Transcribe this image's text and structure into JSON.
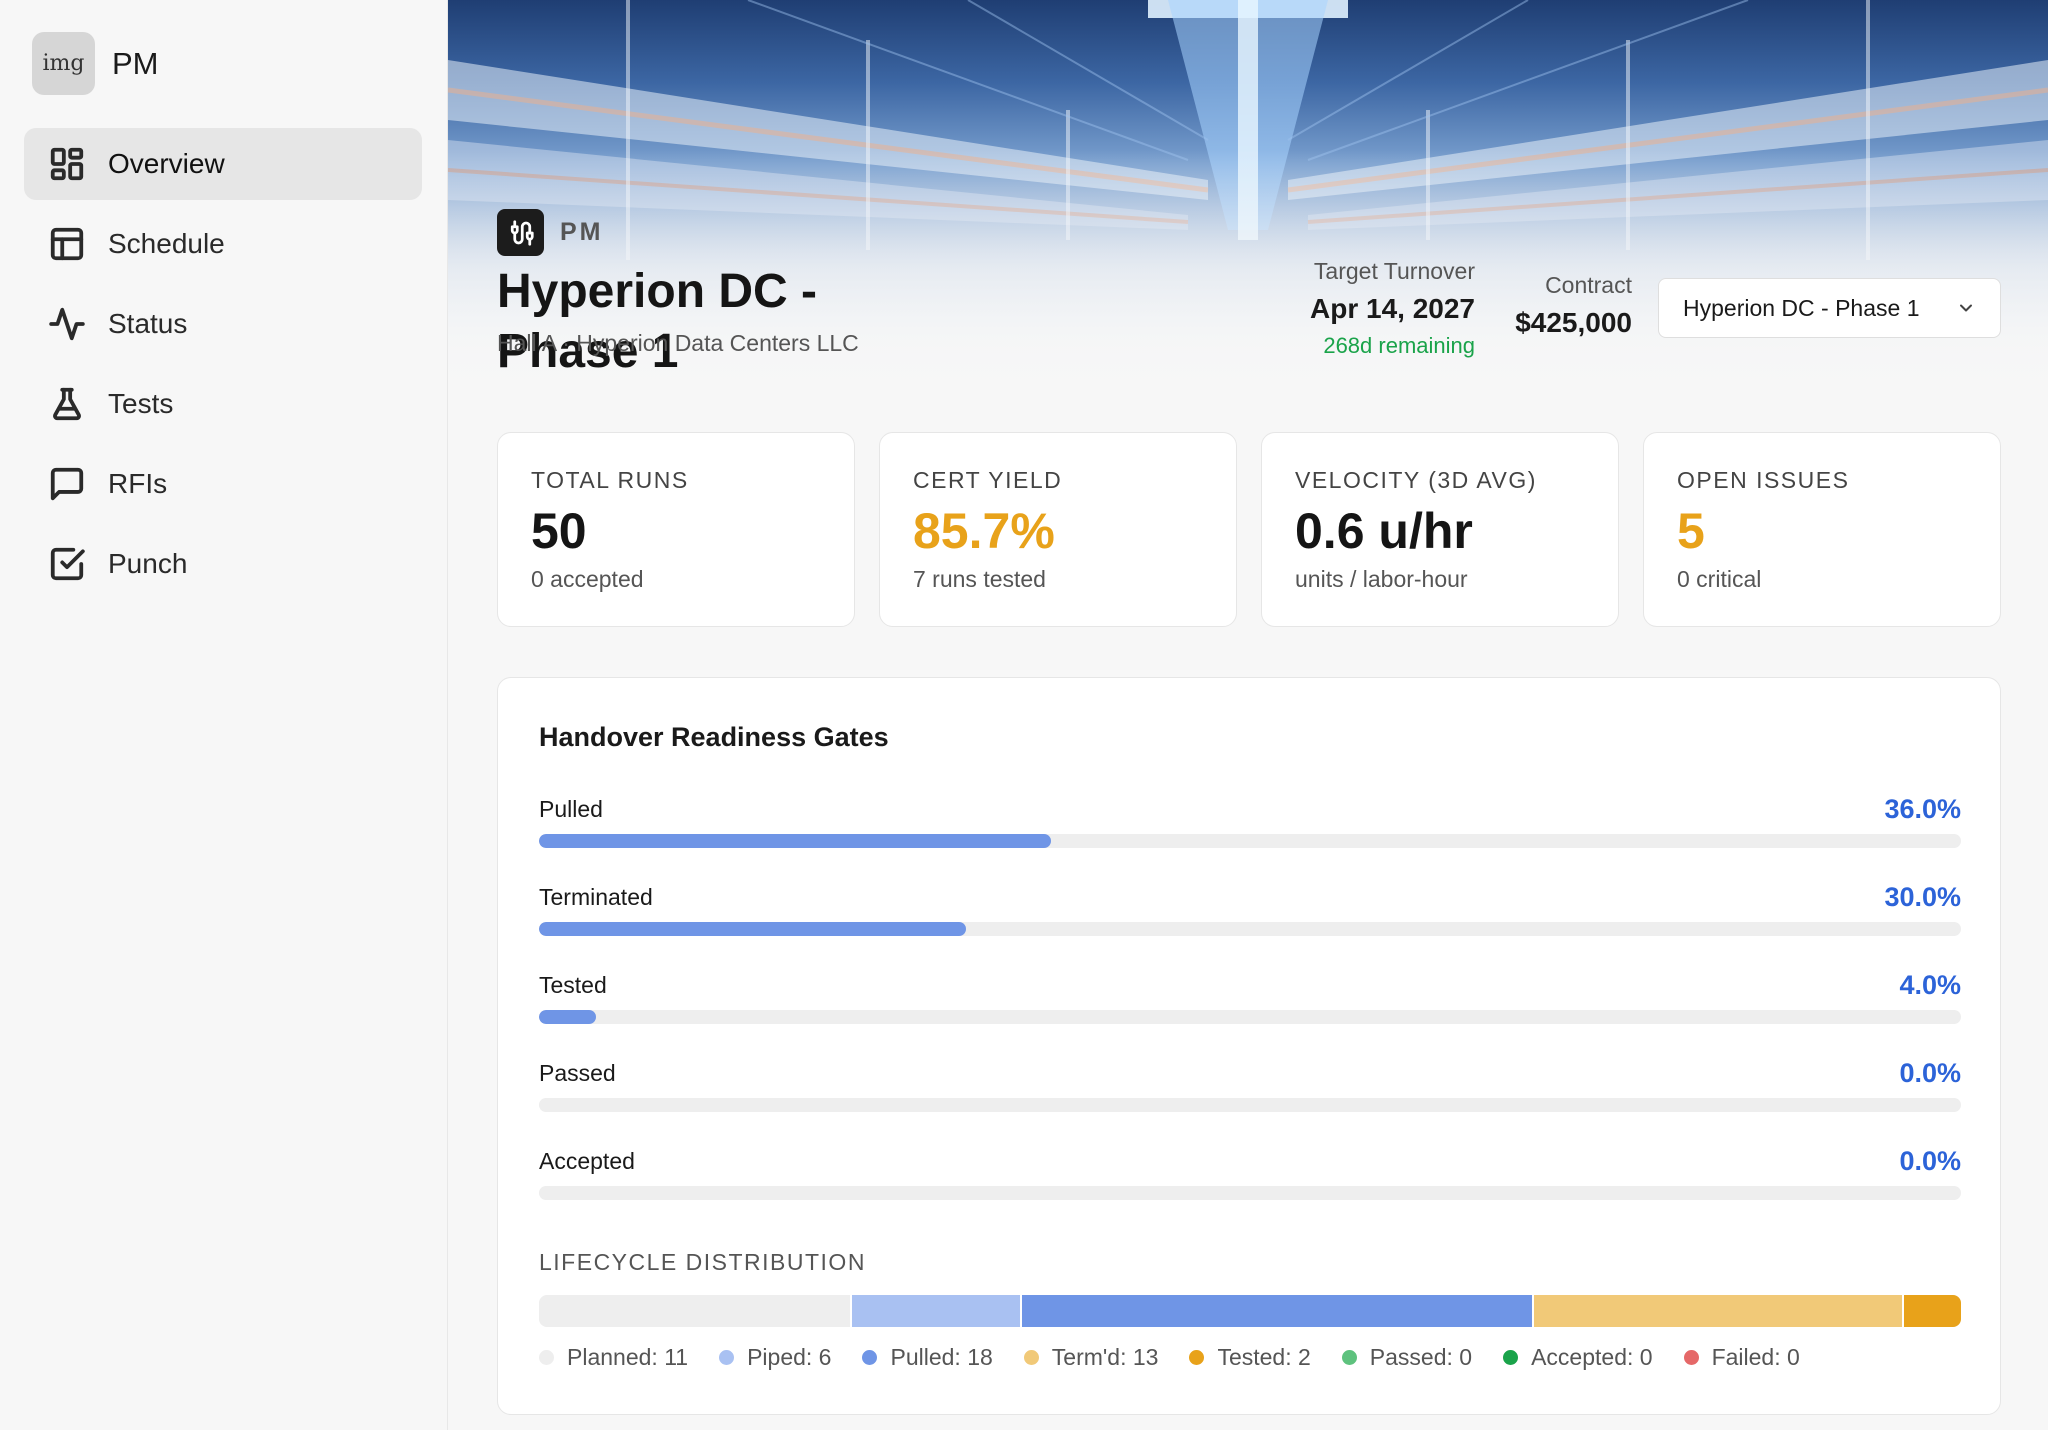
{
  "app": {
    "logo_text": "img",
    "name": "PM"
  },
  "nav": [
    {
      "label": "Overview",
      "icon": "layout-grid-icon",
      "active": true
    },
    {
      "label": "Schedule",
      "icon": "table-icon",
      "active": false
    },
    {
      "label": "Status",
      "icon": "activity-icon",
      "active": false
    },
    {
      "label": "Tests",
      "icon": "flask-icon",
      "active": false
    },
    {
      "label": "RFIs",
      "icon": "message-square-icon",
      "active": false
    },
    {
      "label": "Punch",
      "icon": "check-square-icon",
      "active": false
    }
  ],
  "header": {
    "tag": "PM",
    "badge_icon": "cable-icon",
    "title": "Hyperion DC - Phase 1",
    "subtitle": "Hall A · Hyperion Data Centers LLC",
    "turnover": {
      "label": "Target Turnover",
      "value": "Apr 14, 2027",
      "remaining": "268d remaining"
    },
    "contract": {
      "label": "Contract",
      "value": "$425,000"
    },
    "project_select": {
      "value": "Hyperion DC - Phase 1",
      "icon": "chevron-down-icon"
    }
  },
  "kpis": [
    {
      "label": "TOTAL RUNS",
      "value": "50",
      "sub": "0 accepted",
      "accent": "#151515"
    },
    {
      "label": "CERT YIELD",
      "value": "85.7%",
      "sub": "7 runs tested",
      "accent": "#e8a21a"
    },
    {
      "label": "VELOCITY (3D AVG)",
      "value": "0.6 u/hr",
      "sub": "units / labor-hour",
      "accent": "#151515"
    },
    {
      "label": "OPEN ISSUES",
      "value": "5",
      "sub": "0 critical",
      "accent": "#e8a21a"
    }
  ],
  "readiness": {
    "title": "Handover Readiness Gates",
    "gates": [
      {
        "label": "Pulled",
        "percent_text": "36.0%",
        "value": 0.36
      },
      {
        "label": "Terminated",
        "percent_text": "30.0%",
        "value": 0.3
      },
      {
        "label": "Tested",
        "percent_text": "4.0%",
        "value": 0.04
      },
      {
        "label": "Passed",
        "percent_text": "0.0%",
        "value": 0.0
      },
      {
        "label": "Accepted",
        "percent_text": "0.0%",
        "value": 0.0
      }
    ],
    "bar_color": "#6f95e6",
    "percent_color": "#2c63d8"
  },
  "lifecycle": {
    "title": "LIFECYCLE DISTRIBUTION",
    "items": [
      {
        "label": "Planned: 11",
        "count": 11,
        "color": "#eeeeee"
      },
      {
        "label": "Piped: 6",
        "count": 6,
        "color": "#a9c1f2"
      },
      {
        "label": "Pulled: 18",
        "count": 18,
        "color": "#6f95e6"
      },
      {
        "label": "Term'd: 13",
        "count": 13,
        "color": "#f1c978"
      },
      {
        "label": "Tested: 2",
        "count": 2,
        "color": "#e8a21a"
      },
      {
        "label": "Passed: 0",
        "count": 0,
        "color": "#5ec27e"
      },
      {
        "label": "Accepted: 0",
        "count": 0,
        "color": "#1aa34a"
      },
      {
        "label": "Failed: 0",
        "count": 0,
        "color": "#e56868"
      }
    ]
  }
}
